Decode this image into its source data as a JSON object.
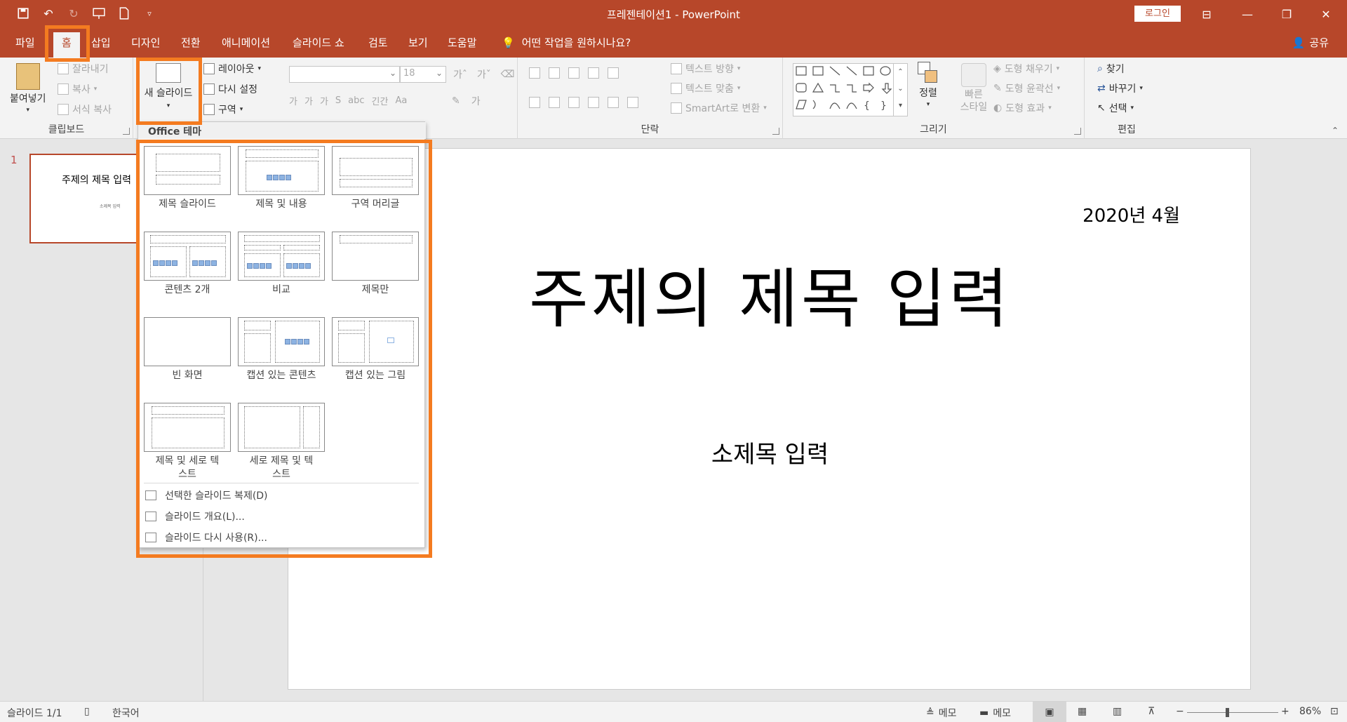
{
  "titlebar": {
    "title": "프레젠테이션1 - PowerPoint",
    "login": "로그인"
  },
  "menu": {
    "tabs": [
      "파일",
      "홈",
      "삽입",
      "디자인",
      "전환",
      "애니메이션",
      "슬라이드 쇼",
      "검토",
      "보기",
      "도움말"
    ],
    "active_tab": "홈",
    "tell_me": "어떤 작업을 원하시나요?",
    "share": "공유"
  },
  "ribbon": {
    "clipboard": {
      "label": "클립보드",
      "paste": "붙여넣기",
      "cut": "잘라내기",
      "copy": "복사",
      "format_painter": "서식 복사"
    },
    "slides": {
      "new_slide": "새 슬라이드",
      "layout": "레이아웃",
      "reset": "다시 설정",
      "section": "구역"
    },
    "font": {
      "size": "18"
    },
    "paragraph": {
      "label": "단락",
      "text_direction": "텍스트 방향",
      "align_text": "텍스트 맞춤",
      "smartart": "SmartArt로 변환"
    },
    "drawing": {
      "label": "그리기",
      "arrange": "정렬",
      "quick_styles": "빠른 스타일",
      "shape_fill": "도형 채우기",
      "shape_outline": "도형 윤곽선",
      "shape_effects": "도형 효과"
    },
    "editing": {
      "label": "편집",
      "find": "찾기",
      "replace": "바꾸기",
      "select": "선택"
    }
  },
  "dropdown": {
    "header": "Office 테마",
    "layouts": [
      "제목 슬라이드",
      "제목 및 내용",
      "구역 머리글",
      "콘텐츠 2개",
      "비교",
      "제목만",
      "빈 화면",
      "캡션 있는 콘텐츠",
      "캡션 있는 그림",
      "제목 및 세로 텍스트",
      "세로 제목 및 텍스트"
    ],
    "commands": [
      "선택한 슬라이드 복제(D)",
      "슬라이드 개요(L)...",
      "슬라이드 다시 사용(R)..."
    ]
  },
  "thumbnail": {
    "number": "1",
    "title": "주제의 제목 입력",
    "subtitle": "소제목 입력"
  },
  "slide": {
    "date": "2020년 4월",
    "title": "주제의 제목 입력",
    "subtitle": "소제목 입력"
  },
  "status": {
    "slide_count": "슬라이드 1/1",
    "language": "한국어",
    "notes": "메모",
    "comments": "메모",
    "zoom": "86%"
  },
  "colors": {
    "accent": "#b7472a",
    "highlight": "#f47b20"
  }
}
